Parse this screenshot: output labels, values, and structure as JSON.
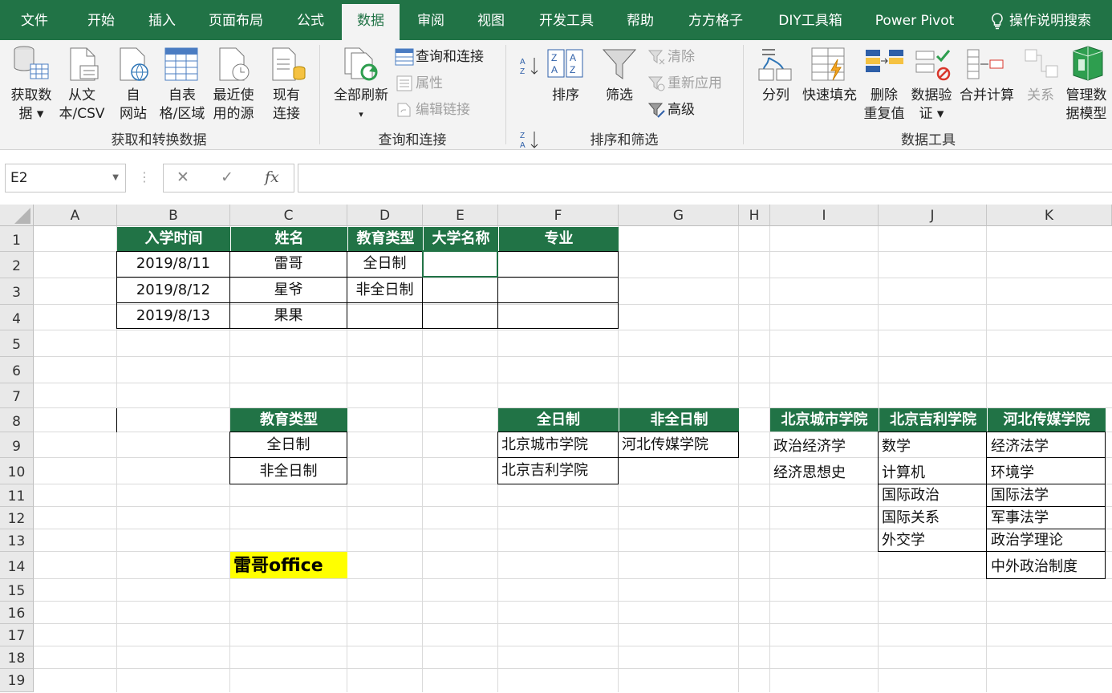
{
  "tabs": [
    "文件",
    "开始",
    "插入",
    "页面布局",
    "公式",
    "数据",
    "审阅",
    "视图",
    "开发工具",
    "帮助",
    "方方格子",
    "DIY工具箱",
    "Power Pivot",
    "操作说明搜索"
  ],
  "active_tab": "数据",
  "ribbon": {
    "get_data": [
      "获取数",
      "据 ▾"
    ],
    "from_text": [
      "从文",
      "本/CSV"
    ],
    "from_web": [
      "自",
      "网站"
    ],
    "from_table": [
      "自表",
      "格/区域"
    ],
    "recent": [
      "最近使",
      "用的源"
    ],
    "existing": [
      "现有",
      "连接"
    ],
    "group_get": "获取和转换数据",
    "refresh_all": "全部刷新",
    "refresh_arrow": "▾",
    "queries": "查询和连接",
    "properties": "属性",
    "edit_links": "编辑链接",
    "group_query": "查询和连接",
    "sort": "排序",
    "filter": "筛选",
    "clear": "清除",
    "reapply": "重新应用",
    "advanced": "高级",
    "group_sort": "排序和筛选",
    "split": "分列",
    "flash": "快速填充",
    "remove_dup": [
      "删除",
      "重复值"
    ],
    "validation": [
      "数据验",
      "证 ▾"
    ],
    "consolidate": "合并计算",
    "relations": "关系",
    "manage": [
      "管理数",
      "据模型"
    ],
    "group_tools": "数据工具"
  },
  "formula_bar": {
    "name_box": "E2",
    "cancel": "✕",
    "enter": "✓",
    "fx": "fx",
    "formula": ""
  },
  "columns": [
    "A",
    "B",
    "C",
    "D",
    "E",
    "F",
    "G",
    "H",
    "I",
    "J",
    "K"
  ],
  "rows": [
    "1",
    "2",
    "3",
    "4",
    "5",
    "6",
    "7",
    "8",
    "9",
    "10",
    "11",
    "12",
    "13",
    "14",
    "15",
    "16",
    "17",
    "18",
    "19"
  ],
  "table1": {
    "headers": [
      "入学时间",
      "姓名",
      "教育类型",
      "大学名称",
      "专业"
    ],
    "rows": [
      [
        "2019/8/11",
        "雷哥",
        "全日制",
        "",
        ""
      ],
      [
        "2019/8/12",
        "星爷",
        "非全日制",
        "",
        ""
      ],
      [
        "2019/8/13",
        "果果",
        "",
        "",
        ""
      ]
    ]
  },
  "edu_list": {
    "header": "教育类型",
    "items": [
      "全日制",
      "非全日制"
    ]
  },
  "uni_table": {
    "headers": [
      "全日制",
      "非全日制"
    ],
    "col1": [
      "北京城市学院",
      "北京吉利学院"
    ],
    "col2": [
      "河北传媒学院"
    ]
  },
  "major_table": {
    "headers": [
      "北京城市学院",
      "北京吉利学院",
      "河北传媒学院"
    ],
    "col1": [
      "政治经济学",
      "经济思想史"
    ],
    "col2": [
      "数学",
      "计算机",
      "国际政治",
      "国际关系",
      "外交学"
    ],
    "col3": [
      "经济法学",
      "环境学",
      "国际法学",
      "军事法学",
      "政治学理论",
      "中外政治制度"
    ]
  },
  "watermark": "雷哥office",
  "colors": {
    "excel_green": "#217346",
    "highlight": "#ffff00"
  }
}
